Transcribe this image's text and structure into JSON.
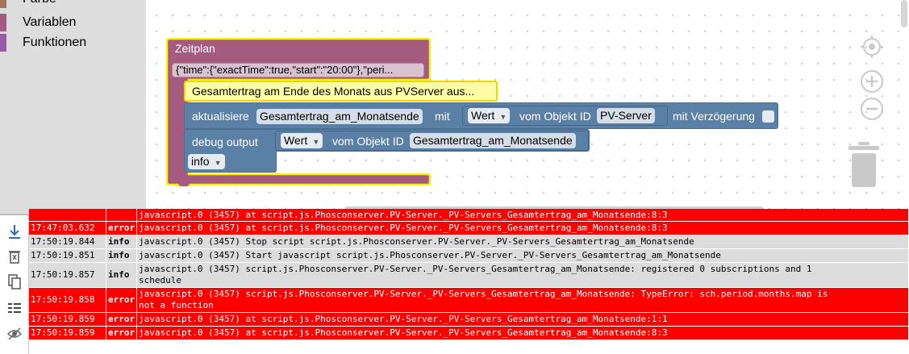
{
  "toolbox": {
    "items": [
      {
        "label": "Farbe",
        "color": "#a5745b"
      },
      {
        "label": "Variablen",
        "color": "#a55b80"
      },
      {
        "label": "Funktionen",
        "color": "#995ba5"
      }
    ]
  },
  "blocks": {
    "schedule": {
      "title": "Zeitplan",
      "field": "{\"time\":{\"exactTime\":true,\"start\":\"20:00\"},\"peri...",
      "color": "#a55b80",
      "highlight": "#fff200"
    },
    "comment": {
      "text": "Gesamtertrag am Ende des Monats aus PVServer aus..."
    },
    "update": {
      "label": "aktualisiere",
      "target": "Gesamtertrag_am_Monatsende",
      "mit": "mit",
      "value_dropdown": "Wert",
      "from_object": "vom Objekt ID",
      "object_id": "PV-Server",
      "delay_label": "mit Verzögerung"
    },
    "debug": {
      "label": "debug output",
      "value_dropdown": "Wert",
      "from_object": "vom Objekt ID",
      "object_id": "Gesamtertrag_am_Monatsende",
      "level_dropdown": "info"
    }
  },
  "log": {
    "rows": [
      {
        "ts": "",
        "sev": "",
        "msg": "javascript.0 (3457) at script.js.Phosconserver.PV-Server._PV-Servers_Gesamtertrag_am_Monatsende:8:3",
        "type": "error"
      },
      {
        "ts": "17:47:03.632",
        "sev": "error",
        "msg": "javascript.0 (3457) at script.js.Phosconserver.PV-Server._PV-Servers_Gesamtertrag_am_Monatsende:8:3",
        "type": "error"
      },
      {
        "ts": "17:50:19.844",
        "sev": "info",
        "msg": "javascript.0 (3457) Stop script script.js.Phosconserver.PV-Server._PV-Servers_Gesamtertrag_am_Monatsende",
        "type": "info"
      },
      {
        "ts": "17:50:19.851",
        "sev": "info",
        "msg": "javascript.0 (3457) Start javascript script.js.Phosconserver.PV-Server._PV-Servers_Gesamtertrag_am_Monatsende",
        "type": "info"
      },
      {
        "ts": "17:50:19.857",
        "sev": "info",
        "msg": "javascript.0 (3457) script.js.Phosconserver.PV-Server._PV-Servers_Gesamtertrag_am_Monatsende: registered 0 subscriptions and 1\nschedule",
        "type": "info"
      },
      {
        "ts": "17:50:19.858",
        "sev": "error",
        "msg": "javascript.0 (3457) script.js.Phosconserver.PV-Server._PV-Servers_Gesamtertrag_am_Monatsende: TypeError: sch.period.months.map is\nnot a function",
        "type": "error"
      },
      {
        "ts": "17:50:19.859",
        "sev": "error",
        "msg": "javascript.0 (3457) at script.js.Phosconserver.PV-Server._PV-Servers_Gesamtertrag_am_Monatsende:1:1",
        "type": "error"
      },
      {
        "ts": "17:50:19.859",
        "sev": "error",
        "msg": "javascript.0 (3457) at script.js.Phosconserver.PV-Server._PV-Servers_Gesamtertrag_am_Monatsende:8:3",
        "type": "error"
      }
    ]
  },
  "icons": [
    "download-icon",
    "clear-log-icon",
    "copy-icon",
    "list-icon",
    "hide-icon",
    "recenter-icon",
    "zoom-in-icon",
    "zoom-out-icon",
    "trash-icon"
  ]
}
